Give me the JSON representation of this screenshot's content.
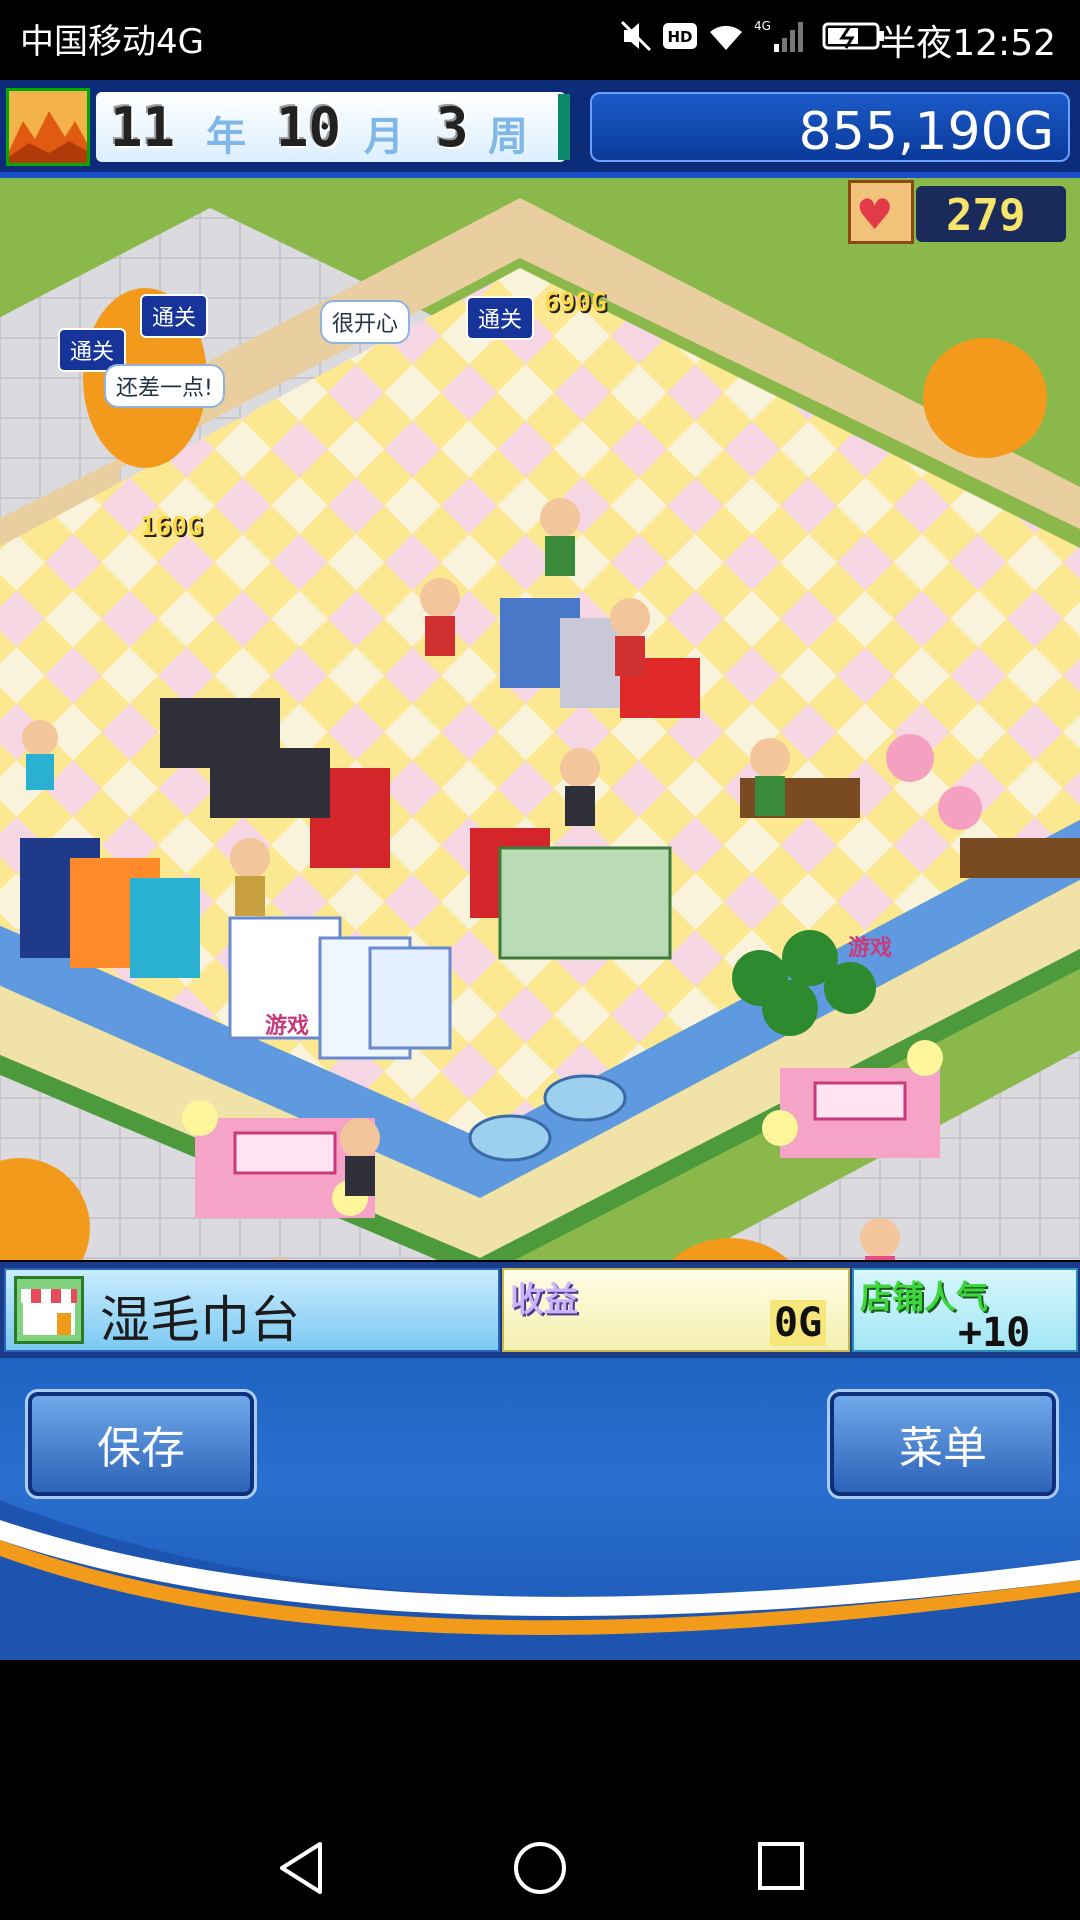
{
  "status_bar": {
    "carrier": "中国移动4G",
    "time": "半夜12:52",
    "icons": [
      "mute-icon",
      "hd-icon",
      "wifi-icon",
      "signal-4g-icon",
      "battery-charging-icon"
    ]
  },
  "hud": {
    "year_value": "11",
    "year_unit": "年",
    "month_value": "10",
    "month_unit": "月",
    "week_value": "3",
    "week_unit": "周",
    "money": "855,190G",
    "popularity": "279"
  },
  "field": {
    "bubbles": {
      "clear_1": "通关",
      "clear_2": "通关",
      "clear_3": "通关",
      "happy": "很开心",
      "almost": "还差一点!"
    },
    "coins": {
      "coin_1": "690G",
      "coin_2": "160G"
    },
    "signs": {
      "gate_left": "游戏",
      "gate_right": "游戏"
    }
  },
  "info_bar": {
    "facility_name": "湿毛巾台",
    "revenue_label": "收益",
    "revenue_value": "0G",
    "shop_pop_label": "店铺人气",
    "shop_pop_value": "+10"
  },
  "menu": {
    "save_label": "保存",
    "menu_label": "菜单"
  },
  "nav": {
    "icons": [
      "back-icon",
      "home-icon",
      "recents-icon"
    ]
  },
  "colors": {
    "hud_blue": "#0c2c7a",
    "money_panel": "#1c5ac8",
    "menu_blue": "#2a6fd0",
    "swoosh_orange": "#f29a1a",
    "floor_yellow": "#fbe890",
    "floor_pink": "#f6d6e2"
  }
}
